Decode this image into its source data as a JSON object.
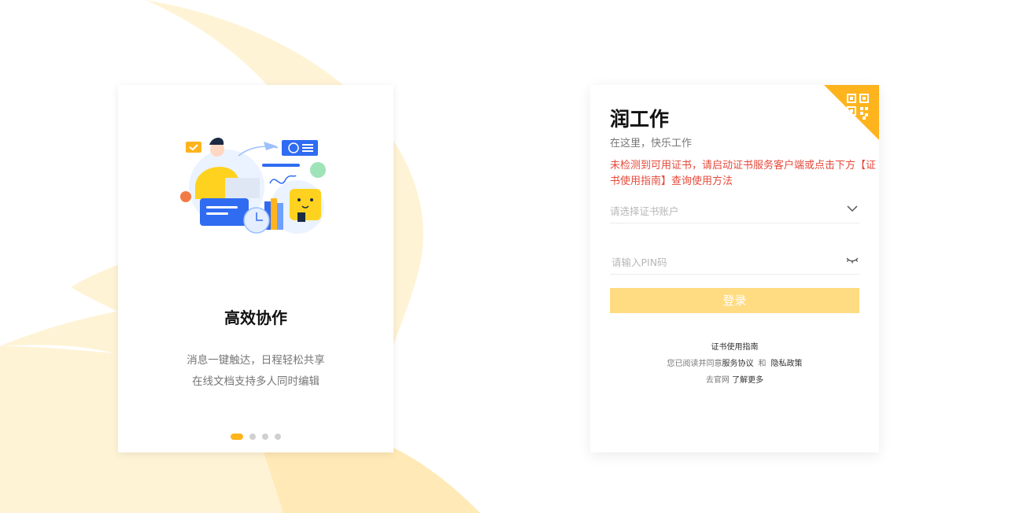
{
  "promo": {
    "title": "高效协作",
    "desc_line1": "消息一键触达，日程轻松共享",
    "desc_line2": "在线文档支持多人同时编辑",
    "carousel_count": 4,
    "carousel_active": 0
  },
  "login": {
    "app_name": "润工作",
    "tagline": "在这里，快乐工作",
    "warning": "未检测到可用证书，请启动证书服务客户端或点击下方【证书使用指南】查询使用方法",
    "account_placeholder": "请选择证书账户",
    "pin_placeholder": "请输入PIN码",
    "login_label": "登录",
    "cert_guide_link": "证书使用指南",
    "agree_prefix": "您已阅读并同意",
    "service_agreement": "服务协议",
    "and_text": "和",
    "privacy_policy": "隐私政策",
    "official_prefix": "去官网",
    "learn_more": "了解更多"
  },
  "icons": {
    "qr_corner": "qr-code-icon",
    "account_dropdown": "chevron-down-icon",
    "pin_toggle": "eye-closed-icon"
  },
  "colors": {
    "accent": "#ffb41e",
    "button": "#ffdb82",
    "warning": "#e64a3c",
    "bg_deco": "#fff1cf"
  }
}
